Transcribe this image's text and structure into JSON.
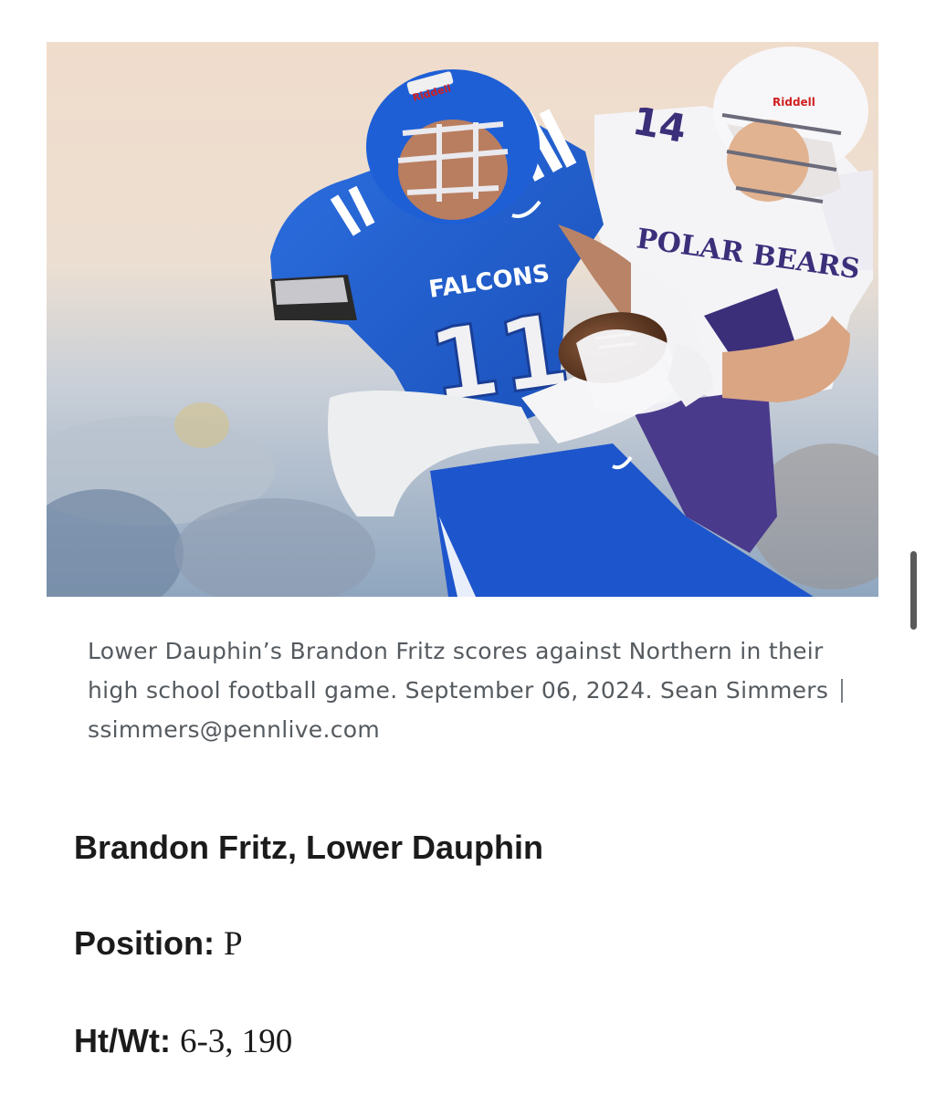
{
  "photo": {
    "alt": "Football players in action",
    "jersey_team": "FALCONS",
    "jersey_number": "11",
    "opponent_jersey_text": "POLAR BEARS",
    "opponent_number": "14",
    "helmet_brand": "Riddell"
  },
  "caption": {
    "text": "Lower Dauphin’s Brandon Fritz scores against Northern in their high school football game. September 06, 2024.",
    "photographer": "Sean Simmers",
    "email": "ssimmers@pennlive.com"
  },
  "player": {
    "name": "Brandon Fritz, Lower Dauphin",
    "position_label": "Position:",
    "position_value": "P",
    "htwt_label": "Ht/Wt:",
    "htwt_value": "6-3, 190"
  },
  "colors": {
    "falcons_blue": "#1f5fd0",
    "polar_purple": "#4a3a8c",
    "caption_gray": "#555a5f"
  }
}
